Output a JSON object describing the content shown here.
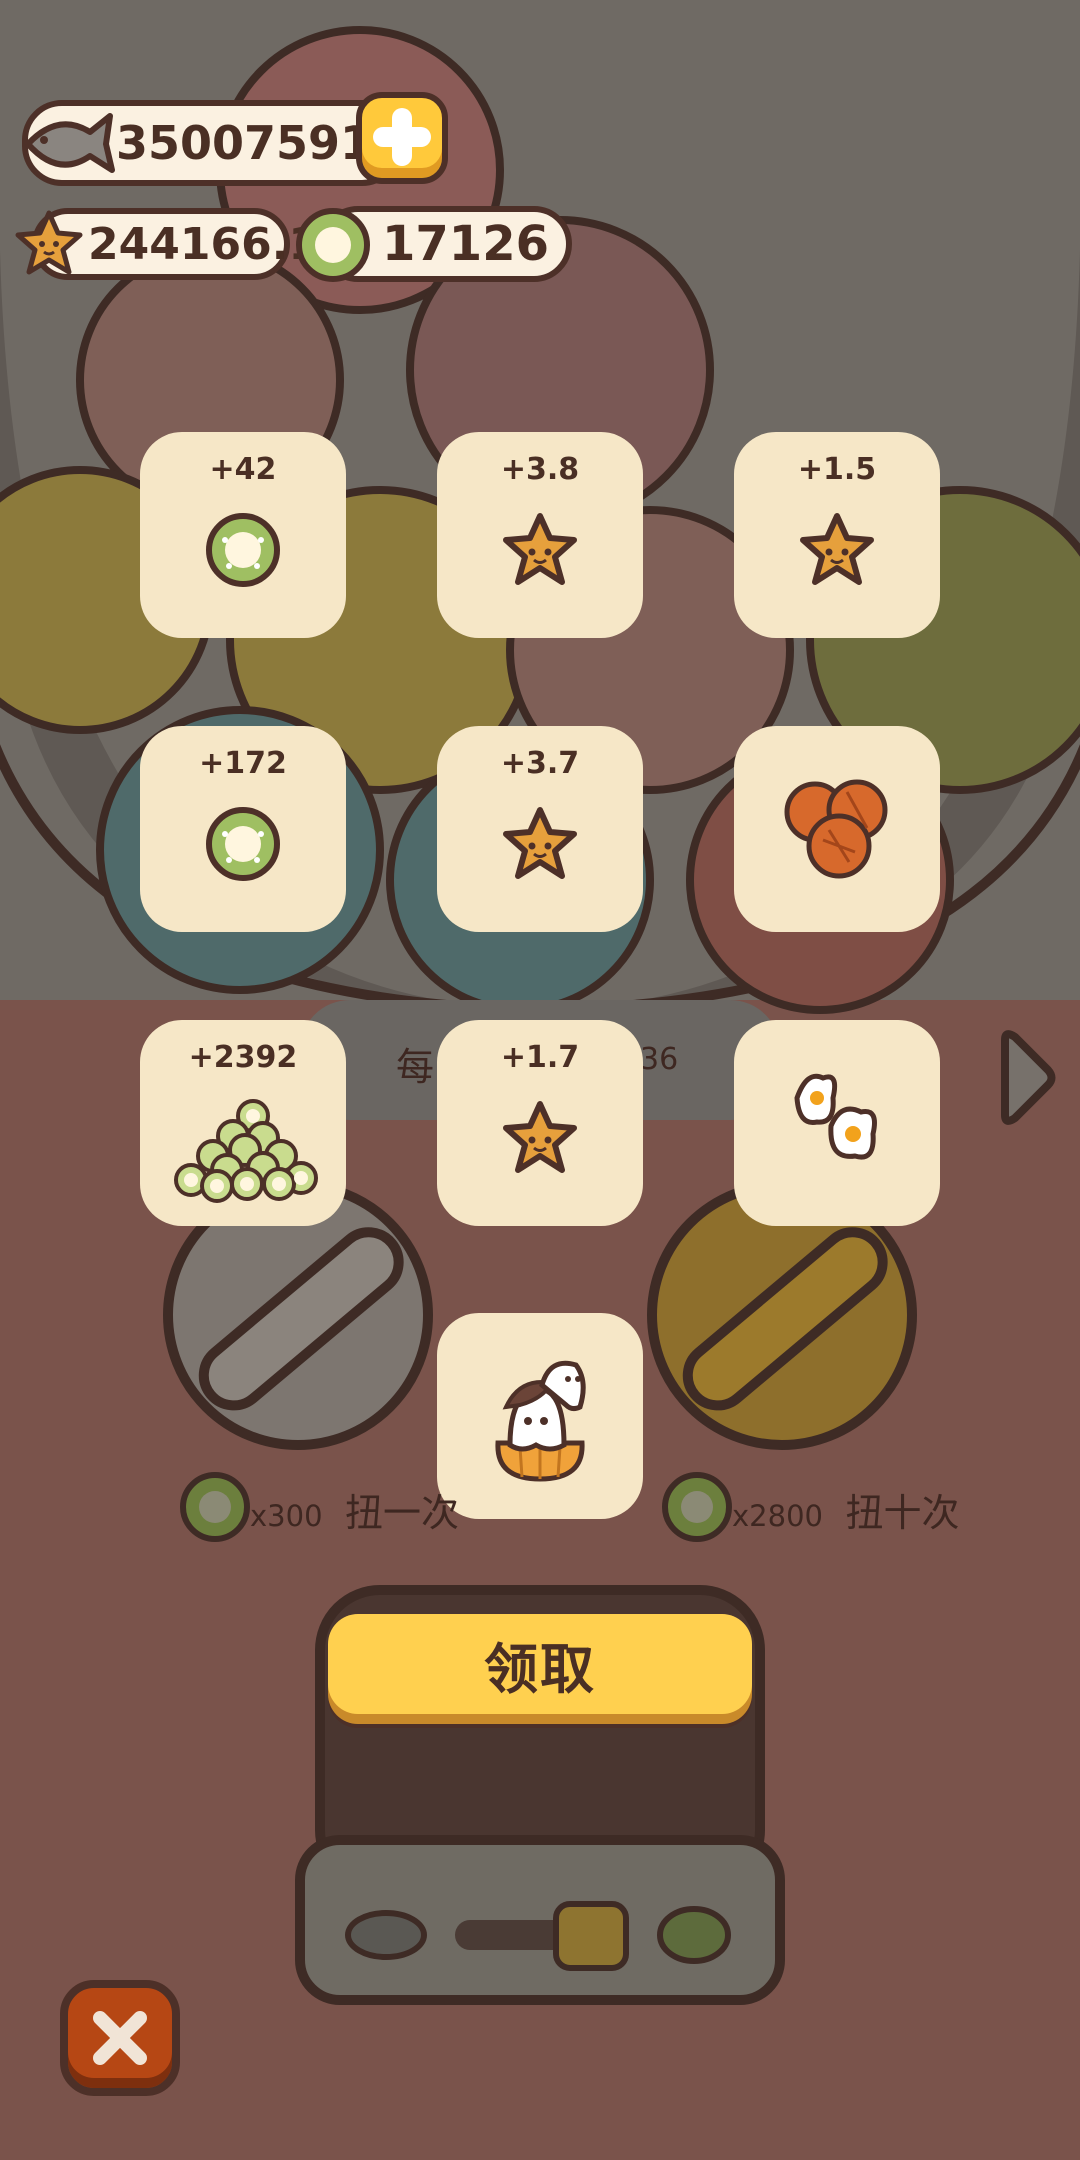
{
  "currency": {
    "fish": "350075912",
    "stars": "244166.1",
    "coins": "17126"
  },
  "rewards": [
    {
      "label": "+42",
      "icon": "green-coin-icon"
    },
    {
      "label": "+3.8",
      "icon": "star-icon"
    },
    {
      "label": "+1.5",
      "icon": "star-icon"
    },
    {
      "label": "+172",
      "icon": "green-coin-icon"
    },
    {
      "label": "+3.7",
      "icon": "star-icon"
    },
    {
      "label": "",
      "icon": "cookies-icon"
    },
    {
      "label": "+2392",
      "icon": "coin-pile-icon"
    },
    {
      "label": "+1.7",
      "icon": "star-icon"
    },
    {
      "label": "",
      "icon": "fried-eggs-icon"
    },
    {
      "label": "",
      "icon": "ghost-pumpkin-icon"
    }
  ],
  "machine": {
    "hidden_text_left": "每",
    "hidden_text_right": "36",
    "spin_once": {
      "cost": "x300",
      "label": "扭一次"
    },
    "spin_ten": {
      "cost": "x2800",
      "label": "扭十次"
    }
  },
  "claim_label": "领取",
  "colors": {
    "background": "#7a534b",
    "tile": "#f6e7c7",
    "claim_button": "#ffd04f",
    "close_button": "#b64714",
    "outline": "#4d3028"
  }
}
